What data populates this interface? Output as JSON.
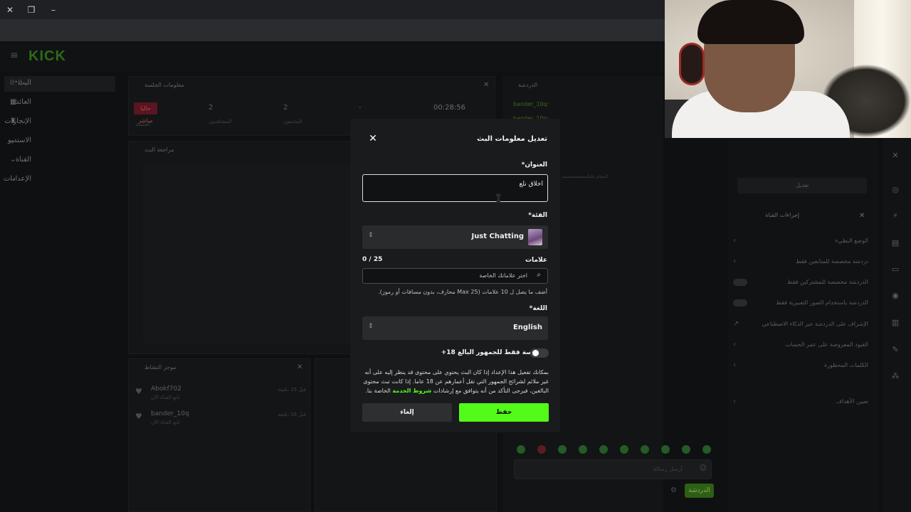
{
  "browser": {
    "close_icon": "close-icon",
    "restore_icon": "restore-icon",
    "minimize_icon": "minimize-icon"
  },
  "app": {
    "logo": "KICK",
    "sidebar": [
      {
        "label": "البث",
        "icon": "broadcast-icon"
      },
      {
        "label": "العائد",
        "icon": "dollar-icon"
      },
      {
        "label": "الإنجازات",
        "icon": "trophy-icon"
      },
      {
        "label": "الاستديو",
        "icon": "studio-icon"
      },
      {
        "label": "القناة",
        "icon": "channel-icon"
      },
      {
        "label": "الإعدادات",
        "icon": "settings-icon"
      }
    ],
    "session_panel": {
      "title": "معلومات الجلسة",
      "live_badge": "حاليا مباشر",
      "stats": [
        {
          "value": "2",
          "label": "المشاهدون"
        },
        {
          "value": "2",
          "label": "المتابعون"
        },
        {
          "value": "-",
          "label": ""
        },
        {
          "value": "00:28:56",
          "label": ""
        }
      ],
      "session_label": "الجلسة"
    },
    "preview_panel": {
      "title": "مراجعة البث"
    },
    "activity_panel": {
      "title": "موجز النشاط",
      "items": [
        {
          "name": "Abokf702",
          "sub": "تابع القناة الآن",
          "time": "قبل 15 دقيقة"
        },
        {
          "name": "bander_10q",
          "sub": "تابع القناة الآن",
          "time": "قبل 18 دقيقة"
        }
      ]
    },
    "chat": {
      "title": "الدردشة",
      "users": [
        "bander_10q:",
        "bander_10q:"
      ],
      "message": "السلام عليكمممممممممم",
      "placeholder": "أرسل رسالة",
      "send": "الدردشة"
    },
    "right_side": {
      "edit_button": "تعديل",
      "actions_title": "إجراءات القناة",
      "rows": [
        {
          "label": "الوضع البطيء",
          "kind": "chevron"
        },
        {
          "label": "دردشة مخصصة للمتابعين فقط",
          "kind": "chevron"
        },
        {
          "label": "الدردشة مخصصة للمشتركين فقط",
          "kind": "toggle"
        },
        {
          "label": "الدردشة باستخدام الصور التعبيرية فقط",
          "kind": "toggle"
        },
        {
          "label": "الإشراف على الدردشة عبر الذكاء الاصطناعي",
          "kind": "link"
        },
        {
          "label": "القيود المفروضة على عمر الحساب",
          "kind": "chevron"
        },
        {
          "label": "الكلمات المحظورة",
          "kind": "chevron"
        },
        {
          "label": "تعيين الأهداف",
          "kind": "chevron"
        }
      ]
    }
  },
  "modal": {
    "title": "تعديل معلومات البث",
    "title_label": "العنوان*",
    "title_value": "اخلاق نلع",
    "category_label": "الفئة*",
    "category_value": "Just Chatting",
    "tags_label": "علامات",
    "tags_count": "0 / 25",
    "tags_placeholder": "اختر علاماتك الخاصة",
    "tags_help": "أضف ما يصل ل 10 علامات (Max 25 محارف، بدون مسافات أو رموز).",
    "language_label": "اللغة*",
    "language_value": "English",
    "age_label": "مخصصة فقط للجمهور البالغ 18+",
    "age_enabled": false,
    "disclaimer_pre": "بمكانك تفعيل هذا الإعداد إذا كان البث يحتوي على محتوى قد ينظر إليه على أنه غير ملائم لشرائح الجمهور التي تقل أعمارهم عن 18 عاما. إذا كانت تبث محتوى البالغين، فيرجى التأكد من أنه يتوافق مع إرشادات",
    "disclaimer_link": "شروط الخدمة",
    "disclaimer_post": "الخاصة بنا.",
    "cancel": "إلغاء",
    "save": "حفظ",
    "accent": "#53fc18"
  }
}
